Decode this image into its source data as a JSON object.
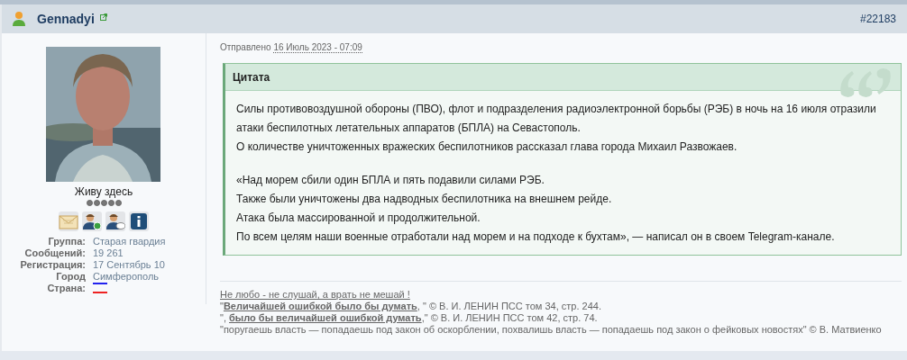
{
  "post": {
    "author": "Gennadyi",
    "number": "#22183"
  },
  "profile": {
    "title": "Живу здесь",
    "stars": 5,
    "fields": [
      {
        "label": "Группа:",
        "value": "Старая гвардия",
        "kind": "text"
      },
      {
        "label": "Сообщений:",
        "value": "19 261",
        "kind": "text"
      },
      {
        "label": "Регистрация:",
        "value": "17 Сентябрь 10",
        "kind": "text"
      },
      {
        "label": "Город",
        "value": "Симферополь",
        "kind": "text"
      },
      {
        "label": "Страна:",
        "kind": "flag"
      }
    ]
  },
  "posted": {
    "label": "Отправлено",
    "date": "16 Июль 2023 - 07:09"
  },
  "quote": {
    "title": "Цитата",
    "paragraphs": [
      [
        "Силы противовоздушной обороны (ПВО), флот и подразделения радиоэлектронной борьбы (РЭБ) в ночь на 16 июля отразили",
        "атаки беспилотных летательных аппаратов (БПЛА) на Севастополь.",
        "О количестве уничтоженных вражеских беспилотников рассказал глава города Михаил Развожаев."
      ],
      [
        "«Над морем сбили один БПЛА и пять подавили силами РЭБ.",
        "Также были уничтожены два надводных беспилотника на внешнем рейде.",
        "Атака была массированной и продолжительной.",
        "По всем целям наши военные отработали над морем и на подходе к бухтам», — написал он в своем Telegram-канале."
      ]
    ]
  },
  "signature": [
    {
      "text": "Не любо - не слушай, а врать не мешай !",
      "kind": "link"
    },
    {
      "text": "\"**Величайшей ошибкой было бы думать**, \" © В. И. ЛЕНИН ПСС том 34, стр. 244.",
      "kind": "text"
    },
    {
      "text": "\", **было бы величайшей ошибкой думать**,\" © В. И. ЛЕНИН ПСС том 42, стр. 74.",
      "kind": "text"
    },
    {
      "text": "\"поругаешь власть — попадаешь под закон об оскорблении, похвалишь власть — попадаешь под закон о фейковых новостях\" © В. Матвиенко",
      "kind": "text"
    }
  ]
}
